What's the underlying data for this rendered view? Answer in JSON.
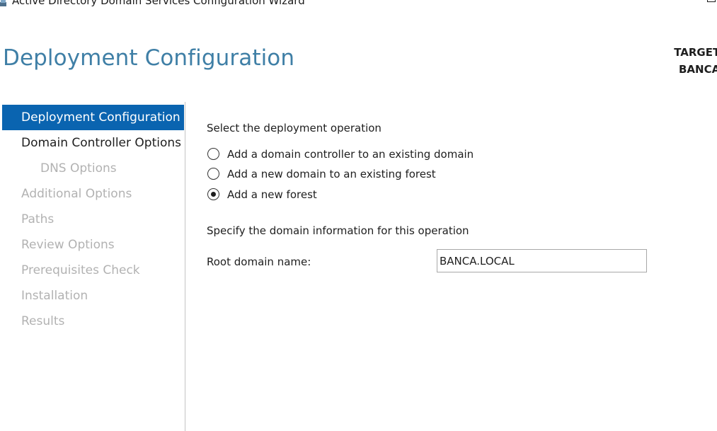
{
  "window": {
    "title": "Active Directory Domain Services Configuration Wizard"
  },
  "header": {
    "title": "Deployment Configuration",
    "target_server_label": "TARGET",
    "target_server_name": "BANCA"
  },
  "sidebar": {
    "items": [
      {
        "label": "Deployment Configuration",
        "state": "active"
      },
      {
        "label": "Domain Controller Options",
        "state": "enabled"
      },
      {
        "label": "DNS Options",
        "state": "disabled"
      },
      {
        "label": "Additional Options",
        "state": "disabled"
      },
      {
        "label": "Paths",
        "state": "disabled"
      },
      {
        "label": "Review Options",
        "state": "disabled"
      },
      {
        "label": "Prerequisites Check",
        "state": "disabled"
      },
      {
        "label": "Installation",
        "state": "disabled"
      },
      {
        "label": "Results",
        "state": "disabled"
      }
    ]
  },
  "main": {
    "operation_heading": "Select the deployment operation",
    "options": [
      {
        "label": "Add a domain controller to an existing domain",
        "checked": false
      },
      {
        "label": "Add a new domain to an existing forest",
        "checked": false
      },
      {
        "label": "Add a new forest",
        "checked": true
      }
    ],
    "domain_info_heading": "Specify the domain information for this operation",
    "root_domain_label": "Root domain name:",
    "root_domain_value": "BANCA.LOCAL"
  },
  "colors": {
    "title_accent": "#3f7fa6",
    "selected_nav": "#0a64b0",
    "disabled_text": "#b2b2b2"
  }
}
